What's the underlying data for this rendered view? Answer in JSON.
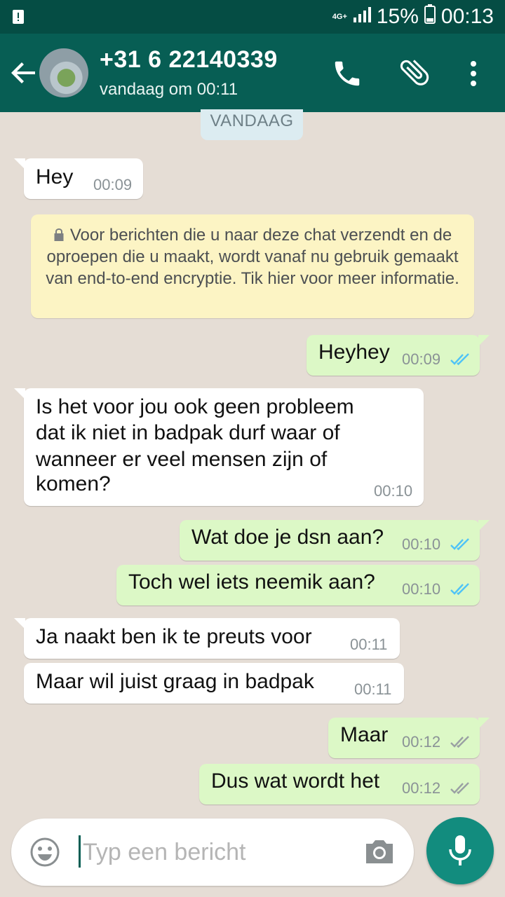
{
  "status_bar": {
    "network": "4G+",
    "battery": "15%",
    "time": "00:13"
  },
  "header": {
    "contact_name": "+31 6 22140339",
    "last_seen": "vandaag om 00:11"
  },
  "chat": {
    "date_chip": "VANDAAG",
    "encryption_notice": "Voor berichten die u naar deze chat verzendt en de oproepen die u maakt, wordt vanaf nu gebruik gemaakt van end-to-end encryptie. Tik hier voor meer informatie.",
    "messages": [
      {
        "direction": "in",
        "text": "Hey",
        "time": "00:09"
      },
      {
        "direction": "out",
        "text": "Heyhey",
        "time": "00:09",
        "status": "read"
      },
      {
        "direction": "in",
        "lines": [
          "Is het voor jou ook geen probleem",
          "dat ik niet in badpak durf waar of",
          "wanneer er veel mensen zijn of",
          "komen?"
        ],
        "time": "00:10"
      },
      {
        "direction": "out",
        "text": "Wat doe je dsn aan?",
        "time": "00:10",
        "status": "read"
      },
      {
        "direction": "out",
        "text": "Toch wel iets neemik aan?",
        "time": "00:10",
        "status": "read"
      },
      {
        "direction": "in",
        "text": "Ja naakt ben ik te preuts voor",
        "time": "00:11"
      },
      {
        "direction": "in",
        "text": "Maar wil juist graag in badpak",
        "time": "00:11"
      },
      {
        "direction": "out",
        "text": "Maar",
        "time": "00:12",
        "status": "delivered"
      },
      {
        "direction": "out",
        "text": "Dus wat wordt het",
        "time": "00:12",
        "status": "delivered"
      }
    ]
  },
  "composer": {
    "placeholder": "Typ een bericht",
    "value": ""
  },
  "colors": {
    "status_bar": "#054d44",
    "app_bar": "#075e54",
    "outgoing_bubble": "#dcf8c6",
    "incoming_bubble": "#ffffff",
    "read_ticks": "#4fc3f7",
    "delivered_ticks": "#9aa0a3",
    "mic_button": "#128c7e"
  },
  "icons": [
    "back-arrow-icon",
    "call-icon",
    "attach-icon",
    "menu-icon",
    "lock-icon",
    "emoji-icon",
    "camera-icon",
    "mic-icon"
  ]
}
